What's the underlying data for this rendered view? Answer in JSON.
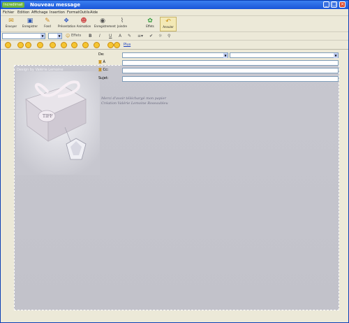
{
  "window": {
    "app_badge": "Incredimail",
    "title": "Nouveau message"
  },
  "menu": [
    "Fichier",
    "Edition",
    "Affichage",
    "Insertion",
    "Format",
    "Outils",
    "Aide"
  ],
  "toolbar": [
    {
      "label": "Envoyer",
      "icon": "send-icon"
    },
    {
      "label": "Enregistrer",
      "icon": "save-icon"
    },
    {
      "label": "Fond",
      "icon": "background-icon"
    },
    {
      "label": "Présentation",
      "icon": "presentation-icon"
    },
    {
      "label": "Animation",
      "icon": "animation-icon"
    },
    {
      "label": "Enregistrement",
      "icon": "record-icon"
    },
    {
      "label": "Joindre",
      "icon": "attach-icon"
    },
    {
      "label": "Effets",
      "icon": "effects-icon"
    },
    {
      "label": "Annuler",
      "icon": "cancel-icon"
    }
  ],
  "format": {
    "font": "",
    "size": "",
    "effects_label": "Effets",
    "bold": "B",
    "italic": "I",
    "underline": "U",
    "font_color": "A"
  },
  "emoticons": {
    "more_label": "Plus"
  },
  "header": {
    "from_label": "De:",
    "from_value": "",
    "to_label": "À",
    "cc_label": "Cc:",
    "subject_label": "Sujet:",
    "signature_select": ""
  },
  "compose": {
    "banner": "Design by Valérie Lemoine",
    "line1": "Merci d'avoir téléchargé mon papier",
    "line2": "Création Valérie Lemoine Roseaubleu"
  },
  "colors": {
    "titlebar": "#1a55d8",
    "compose_bg": "#c7c7cf",
    "toolbar": "#ece9d8"
  }
}
